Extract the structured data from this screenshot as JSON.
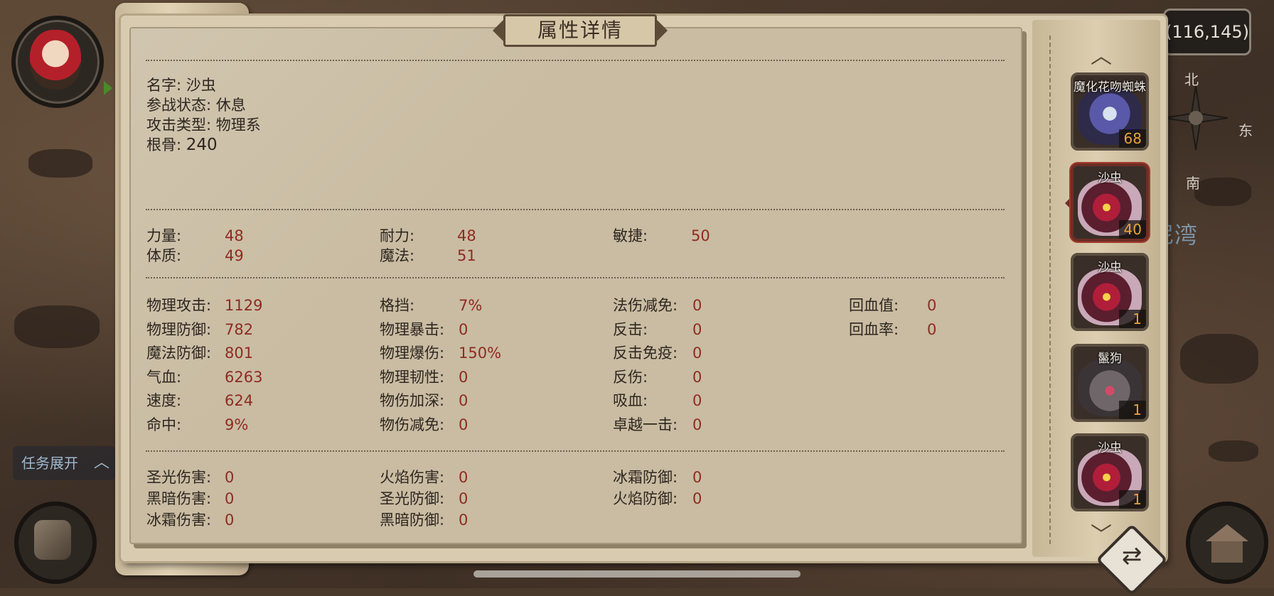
{
  "panel": {
    "title": "属性详情"
  },
  "info": {
    "name_label": "名字:",
    "name_value": "沙虫",
    "status_label": "参战状态:",
    "status_value": "休息",
    "attack_type_label": "攻击类型:",
    "attack_type_value": "物理系",
    "root_label": "根骨:",
    "root_value": "240"
  },
  "base_stats": [
    {
      "label": "力量:",
      "value": "48"
    },
    {
      "label": "耐力:",
      "value": "48"
    },
    {
      "label": "敏捷:",
      "value": "50"
    },
    {
      "label": "体质:",
      "value": "49"
    },
    {
      "label": "魔法:",
      "value": "51"
    }
  ],
  "combat_stats": {
    "col1": [
      {
        "label": "物理攻击:",
        "value": "1129"
      },
      {
        "label": "物理防御:",
        "value": "782"
      },
      {
        "label": "魔法防御:",
        "value": "801"
      },
      {
        "label": "气血:",
        "value": "6263"
      },
      {
        "label": "速度:",
        "value": "624"
      },
      {
        "label": "命中:",
        "value": "9%"
      }
    ],
    "col2": [
      {
        "label": "格挡:",
        "value": "7%"
      },
      {
        "label": "物理暴击:",
        "value": "0"
      },
      {
        "label": "物理爆伤:",
        "value": "150%"
      },
      {
        "label": "物理韧性:",
        "value": "0"
      },
      {
        "label": "物伤加深:",
        "value": "0"
      },
      {
        "label": "物伤减免:",
        "value": "0"
      }
    ],
    "col3": [
      {
        "label": "法伤减免:",
        "value": "0"
      },
      {
        "label": "反击:",
        "value": "0"
      },
      {
        "label": "反击免疫:",
        "value": "0"
      },
      {
        "label": "反伤:",
        "value": "0"
      },
      {
        "label": "吸血:",
        "value": "0"
      },
      {
        "label": "卓越一击:",
        "value": "0"
      }
    ],
    "col4": [
      {
        "label": "回血值:",
        "value": "0"
      },
      {
        "label": "回血率:",
        "value": "0"
      }
    ]
  },
  "element_stats": {
    "col1": [
      {
        "label": "圣光伤害:",
        "value": "0"
      },
      {
        "label": "黑暗伤害:",
        "value": "0"
      },
      {
        "label": "冰霜伤害:",
        "value": "0"
      }
    ],
    "col2": [
      {
        "label": "火焰伤害:",
        "value": "0"
      },
      {
        "label": "圣光防御:",
        "value": "0"
      },
      {
        "label": "黑暗防御:",
        "value": "0"
      }
    ],
    "col3": [
      {
        "label": "冰霜防御:",
        "value": "0"
      },
      {
        "label": "火焰防御:",
        "value": "0"
      }
    ]
  },
  "pets": [
    {
      "name": "魔化花吻蜘蛛",
      "level": "68",
      "art": "spider",
      "selected": false
    },
    {
      "name": "沙虫",
      "level": "40",
      "art": "worm",
      "selected": true
    },
    {
      "name": "沙虫",
      "level": "1",
      "art": "worm",
      "selected": false
    },
    {
      "name": "鬣狗",
      "level": "1",
      "art": "dog",
      "selected": false
    },
    {
      "name": "沙虫",
      "level": "1",
      "art": "worm",
      "selected": false
    }
  ],
  "pet_list": {
    "up_arrow": "︿",
    "down_arrow": "﹀"
  },
  "hud": {
    "coordinates": "(116,145)",
    "compass_north": "北",
    "compass_east": "东",
    "compass_south": "南",
    "place_name": "尼湾",
    "task_toggle": "任务展开",
    "task_toggle_icon": "chevron-up-icon"
  }
}
